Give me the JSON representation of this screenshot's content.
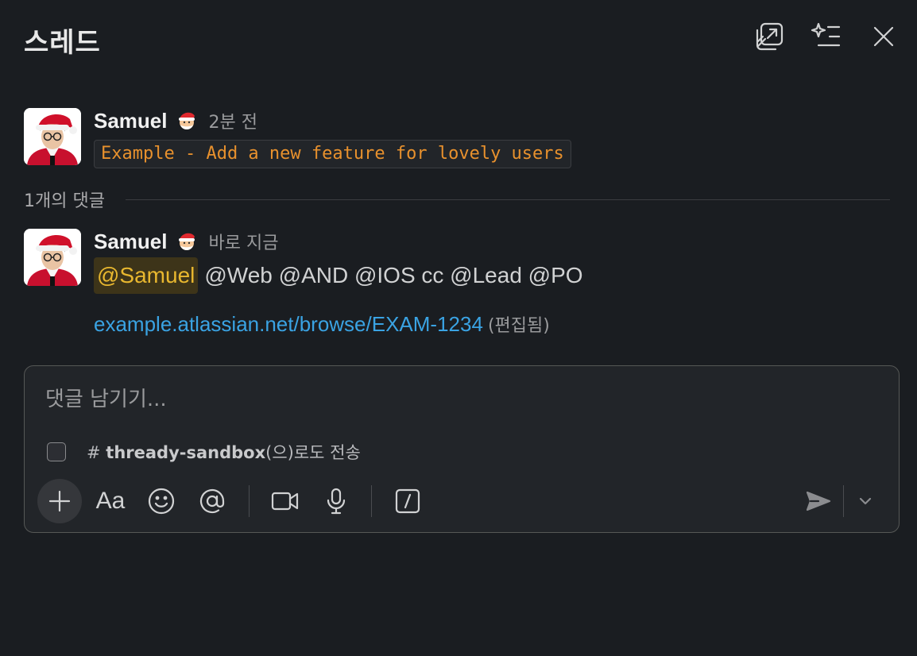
{
  "header": {
    "title": "스레드",
    "icons": [
      "open-in-new-window-icon",
      "ai-summary-icon",
      "close-icon"
    ]
  },
  "messages": [
    {
      "author": "Samuel",
      "status_emoji": "santa-emoji",
      "timestamp": "2분 전",
      "code_text": "Example - Add a new feature for lovely users"
    },
    {
      "author": "Samuel",
      "status_emoji": "santa-emoji",
      "timestamp": "바로 지금",
      "mention_self": "@Samuel",
      "mention_rest": "@Web @AND @IOS cc @Lead @PO",
      "link": "example.atlassian.net/browse/EXAM-1234",
      "edited": "(편집됨)"
    }
  ],
  "divider": {
    "label": "1개의 댓글"
  },
  "composer": {
    "placeholder": "댓글 남기기...",
    "also_send_prefix": "# ",
    "also_send_channel": "thready-sandbox",
    "also_send_suffix": "(으)로도 전송",
    "also_send_checked": false,
    "format_label": "Aa"
  },
  "colors": {
    "background": "#1a1d21",
    "code": "#e8912d",
    "mention_bg": "#3d3419",
    "mention_fg": "#e8b72f",
    "link": "#3aa3e3"
  }
}
